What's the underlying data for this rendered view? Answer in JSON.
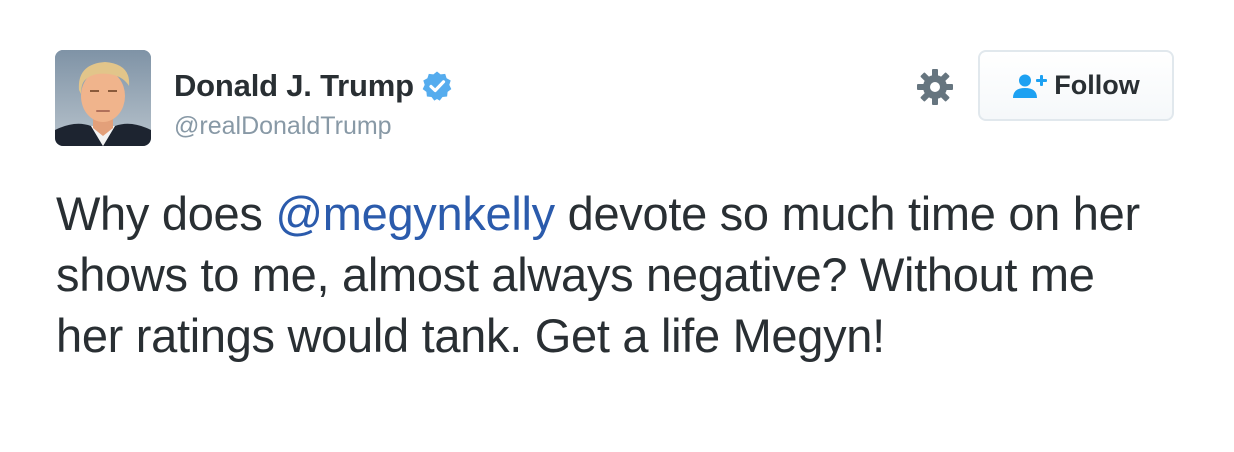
{
  "tweet": {
    "author": {
      "display_name": "Donald J. Trump",
      "handle": "@realDonaldTrump",
      "verified": true
    },
    "actions": {
      "settings_icon": "gear-icon",
      "follow_label": "Follow",
      "follow_icon": "add-user-icon"
    },
    "body": {
      "text_before": "Why does ",
      "mention": "@megynkelly",
      "text_after": " devote so much time on her shows to me, almost always negative? Without me her ratings would tank. Get a life Megyn!"
    }
  },
  "colors": {
    "text": "#292f33",
    "handle": "#8899a6",
    "mention": "#2b5bac",
    "verified": "#55acee",
    "follow_icon": "#1da1f2",
    "gear": "#66757f",
    "button_border": "#e1e8ed"
  }
}
